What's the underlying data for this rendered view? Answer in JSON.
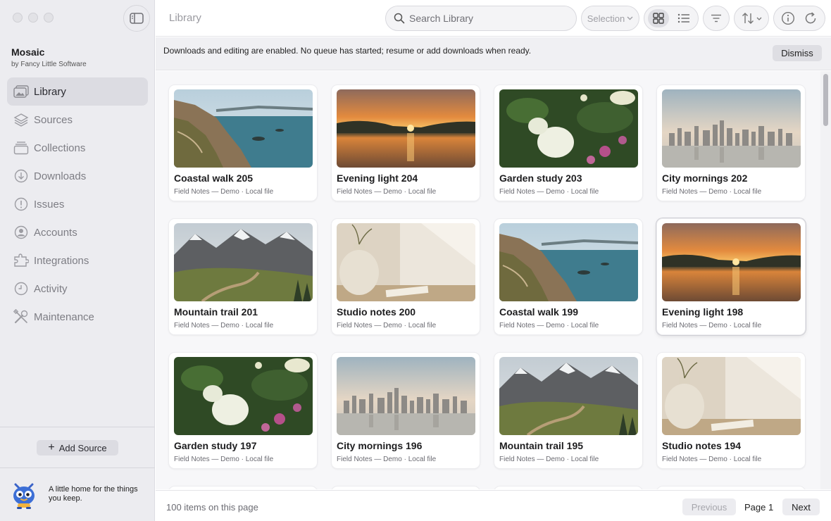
{
  "app": {
    "name": "Mosaic",
    "byline": "by Fancy Little Software",
    "tagline": "A little home for the things you keep."
  },
  "sidebar": {
    "items": [
      {
        "label": "Library",
        "icon": "photo-library-icon",
        "active": true
      },
      {
        "label": "Sources",
        "icon": "layers-icon",
        "active": false
      },
      {
        "label": "Collections",
        "icon": "collections-icon",
        "active": false
      },
      {
        "label": "Downloads",
        "icon": "download-icon",
        "active": false
      },
      {
        "label": "Issues",
        "icon": "exclamation-icon",
        "active": false
      },
      {
        "label": "Accounts",
        "icon": "person-circle-icon",
        "active": false
      },
      {
        "label": "Integrations",
        "icon": "puzzle-icon",
        "active": false
      },
      {
        "label": "Activity",
        "icon": "clock-icon",
        "active": false
      },
      {
        "label": "Maintenance",
        "icon": "tools-icon",
        "active": false
      }
    ],
    "add_source_label": "Add Source"
  },
  "toolbar": {
    "title": "Library",
    "search_placeholder": "Search Library",
    "selection_label": "Selection",
    "view_mode": "grid"
  },
  "banner": {
    "text": "Downloads and editing are enabled. No queue has started; resume or add downloads when ready.",
    "dismiss_label": "Dismiss"
  },
  "items": [
    {
      "title": "Coastal walk 205",
      "meta": "Field Notes — Demo · Local file",
      "scene": "coastal"
    },
    {
      "title": "Evening light 204",
      "meta": "Field Notes — Demo · Local file",
      "scene": "sunset"
    },
    {
      "title": "Garden study 203",
      "meta": "Field Notes — Demo · Local file",
      "scene": "garden"
    },
    {
      "title": "City mornings 202",
      "meta": "Field Notes — Demo · Local file",
      "scene": "city"
    },
    {
      "title": "Mountain trail 201",
      "meta": "Field Notes — Demo · Local file",
      "scene": "mountain"
    },
    {
      "title": "Studio notes 200",
      "meta": "Field Notes — Demo · Local file",
      "scene": "studio"
    },
    {
      "title": "Coastal walk 199",
      "meta": "Field Notes — Demo · Local file",
      "scene": "coastal"
    },
    {
      "title": "Evening light 198",
      "meta": "Field Notes — Demo · Local file",
      "scene": "sunset",
      "selected": true
    },
    {
      "title": "Garden study 197",
      "meta": "Field Notes — Demo · Local file",
      "scene": "garden"
    },
    {
      "title": "City mornings 196",
      "meta": "Field Notes — Demo · Local file",
      "scene": "city"
    },
    {
      "title": "Mountain trail 195",
      "meta": "Field Notes — Demo · Local file",
      "scene": "mountain"
    },
    {
      "title": "Studio notes 194",
      "meta": "Field Notes — Demo · Local file",
      "scene": "studio"
    }
  ],
  "footer": {
    "count_text": "100 items on this page",
    "previous_label": "Previous",
    "page_label": "Page 1",
    "next_label": "Next"
  },
  "colors": {
    "sidebar_bg": "#ececf0",
    "active_item_bg": "#dcdce2",
    "content_bg": "#f7f7f9"
  }
}
